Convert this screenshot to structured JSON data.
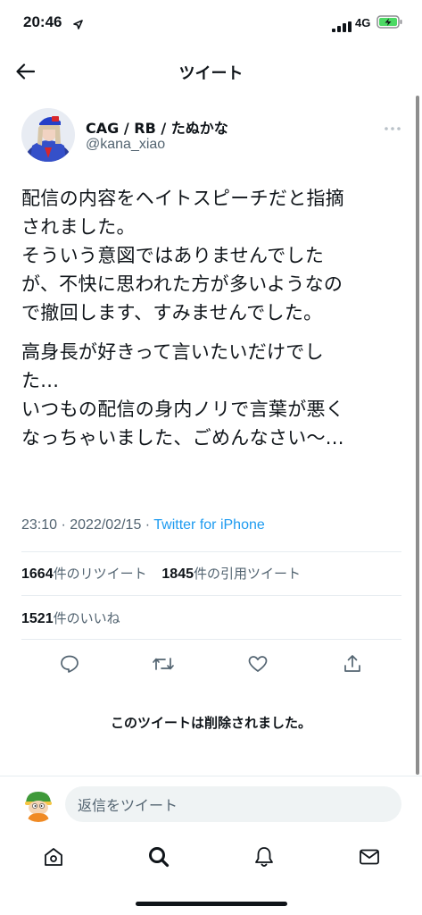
{
  "status_bar": {
    "time": "20:46",
    "network": "4G"
  },
  "header": {
    "title": "ツイート"
  },
  "tweet": {
    "author_name": "CAG / RB / たぬかな",
    "author_handle": "@kana_xiao",
    "paragraphs": [
      "配信の内容をヘイトスピーチだと指摘\nされました。\nそういう意図ではありませんでした\nが、不快に思われた方が多いようなの\nで撤回します、すみませんでした。",
      "高身長が好きって言いたいだけでし\nた...\nいつもの配信の身内ノリで言葉が悪く\nなっちゃいました、ごめんなさい〜..."
    ],
    "timestamp": "23:10 · 2022/02/15 · ",
    "source": "Twitter for iPhone",
    "retweets": {
      "count": "1664",
      "label": "件のリツイート"
    },
    "quotes": {
      "count": "1845",
      "label": "件の引用ツイート"
    },
    "likes": {
      "count": "1521",
      "label": "件のいいね"
    }
  },
  "deleted_notice": "このツイートは削除されました。",
  "reply": {
    "placeholder": "返信をツイート"
  },
  "icons": {
    "back": "arrow-left-icon",
    "more": "ellipsis-icon",
    "reply": "comment-icon",
    "retweet": "retweet-icon",
    "like": "heart-icon",
    "share": "share-icon",
    "home": "home-icon",
    "search": "search-icon",
    "notifications": "bell-icon",
    "messages": "mail-icon"
  },
  "colors": {
    "accent": "#1d9bf0",
    "secondary_text": "#536471",
    "battery_charge": "#4cd964"
  }
}
